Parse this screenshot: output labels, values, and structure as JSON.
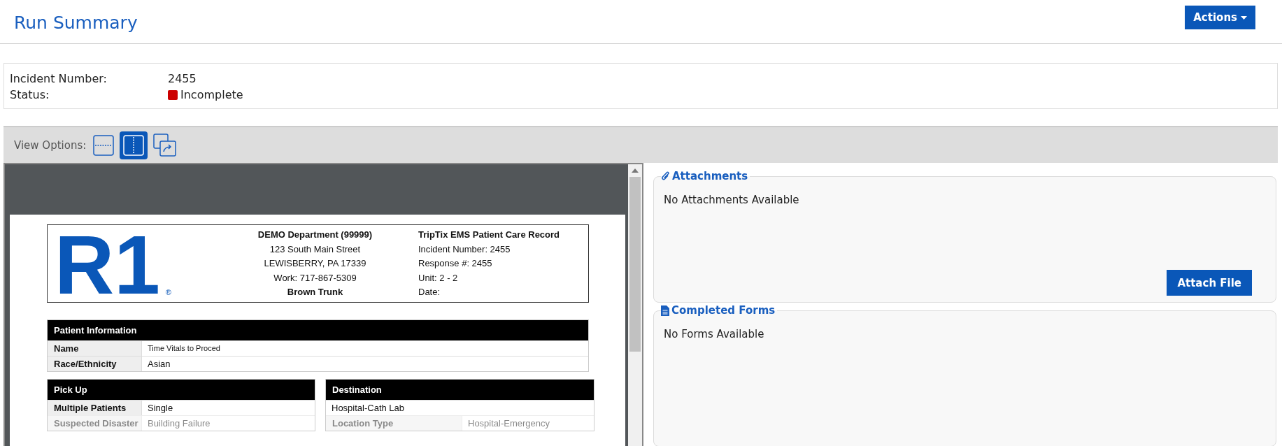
{
  "header": {
    "title": "Run Summary",
    "actions_button": "Actions"
  },
  "summary": {
    "fields": [
      {
        "label": "Incident Number:",
        "value": "2455"
      },
      {
        "label": "Status:",
        "value": "Incomplete",
        "color": "#cc0000"
      }
    ]
  },
  "view_options": {
    "label": "View Options:",
    "options": [
      {
        "kind": "horizontal",
        "selected": false
      },
      {
        "kind": "vertical",
        "selected": true
      },
      {
        "kind": "popout",
        "selected": false
      }
    ]
  },
  "document": {
    "logo": "R1",
    "logo_mark": "®",
    "department": [
      "DEMO Department (99999)",
      "123 South Main Street",
      "LEWISBERRY, PA 17339",
      "Work: 717-867-5309",
      "Brown Trunk"
    ],
    "record": [
      "TripTix EMS Patient Care Record",
      "Incident Number:  2455",
      "Response #:  2455",
      "Unit:  2 - 2",
      "Date:"
    ],
    "patient_info": {
      "title": "Patient Information",
      "rows": [
        {
          "label": "Name",
          "value": "Time Vitals to Proced"
        },
        {
          "label": "Race/Ethnicity",
          "value": "Asian"
        }
      ]
    },
    "pick_up": {
      "title": "Pick Up",
      "rows": [
        {
          "label": "Multiple Patients",
          "value": "Single"
        },
        {
          "label": "Suspected Disaster",
          "value": "Building Failure"
        }
      ]
    },
    "destination": {
      "title": "Destination",
      "value": "Hospital-Cath Lab",
      "rows": [
        {
          "label": "Location Type",
          "value": "Hospital-Emergency"
        }
      ]
    }
  },
  "attachments": {
    "title": "Attachments",
    "empty_text": "No Attachments Available",
    "button": "Attach File"
  },
  "completed_forms": {
    "title": "Completed Forms",
    "empty_text": "No Forms Available"
  }
}
